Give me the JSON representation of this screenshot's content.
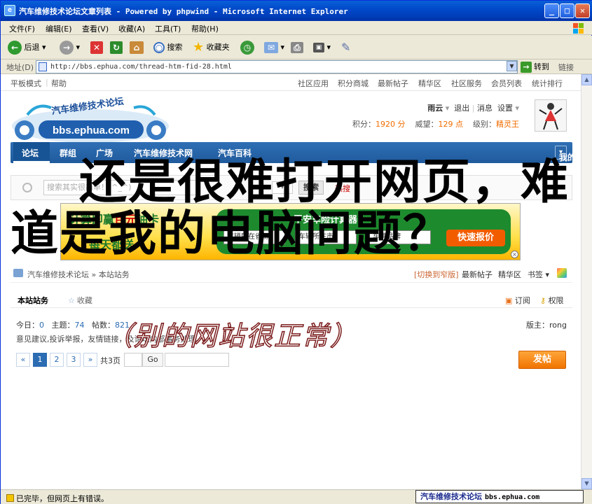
{
  "window": {
    "title": "汽车维修技术论坛文章列表 - Powered by phpwind - Microsoft Internet Explorer",
    "min_glyph": "_",
    "max_glyph": "□",
    "close_glyph": "✕"
  },
  "menu": [
    "文件(F)",
    "编辑(E)",
    "查看(V)",
    "收藏(A)",
    "工具(T)",
    "帮助(H)"
  ],
  "toolbar": {
    "back": "后退",
    "search": "搜索",
    "favorites": "收藏夹"
  },
  "address": {
    "label": "地址(D)",
    "url": "http://bbs.ephua.com/thread-htm-fid-28.html",
    "go": "转到",
    "links": "链接"
  },
  "forum": {
    "top_left": [
      "平板模式",
      "帮助"
    ],
    "top_right": [
      "社区应用",
      "积分商城",
      "最新帖子",
      "精华区",
      "社区服务",
      "会员列表",
      "统计排行"
    ],
    "logo_text": "汽车维修技术论坛",
    "logo_url": "bbs.ephua.com",
    "user": {
      "name": "雨云",
      "logout": "退出",
      "msg": "消息",
      "settings": "设置",
      "points_label": "积分：",
      "points": "1920 分",
      "prestige_label": "威望：",
      "prestige": "129 点",
      "level_label": "级别：",
      "level": "精灵王"
    },
    "nav": [
      "论坛",
      "群组",
      "广场",
      "汽车维修技术网",
      "汽车百科"
    ],
    "quick_nav": "我的快捷通道",
    "search": {
      "placeholder": "搜索其实很简单！(^_^)",
      "button": "搜索",
      "hot": "热搜"
    },
    "ad": {
      "line1_a": "计算即赢",
      "line1_b": "百元",
      "line1_c": "油卡",
      "line2": "每天都送",
      "calc_title": "平安车险计算器",
      "sel1": "车辆所在省份",
      "sel2": "车辆所在市",
      "sel3": "车辆品牌",
      "quote": "快速报价"
    },
    "crumbs": {
      "path": "汽车维修技术论坛 » 本站站务",
      "switch": "[切换到窄版]",
      "latest": "最新帖子",
      "digest": "精华区",
      "bookmark": "书签"
    },
    "board": {
      "name": "本站站务",
      "favorite": "收藏",
      "subscribe": "订阅",
      "permission": "权限",
      "today_label": "今日：",
      "today": "0",
      "topics_label": "主题：",
      "topics": "74",
      "posts_label": "帖数：",
      "posts": "821",
      "moderator": "版主：rong",
      "desc": "意见建议,投诉举报，友情链接，及论坛内部事务处理。"
    },
    "pager": {
      "prev": "«",
      "pages": [
        "1",
        "2",
        "3"
      ],
      "next": "»",
      "total": "共3页",
      "go": "Go"
    },
    "post_button": "发帖"
  },
  "overlay": {
    "question": "还是很难打开网页，难道是我的电脑问题？",
    "note": "（别的网站很正常）"
  },
  "status": {
    "text": "已完毕，但网页上有错误。",
    "site_name": "汽车维修技术论坛",
    "site_url": "bbs.ephua.com"
  }
}
